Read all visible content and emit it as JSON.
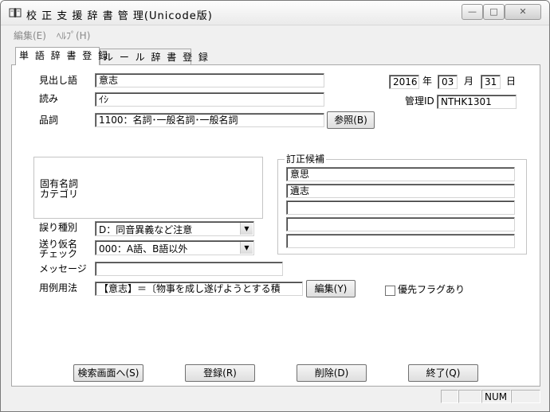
{
  "window": {
    "title": "校 正 支 援 辞 書 管 理(Unicode版)",
    "minimize_glyph": "—",
    "maximize_glyph": "□",
    "close_glyph": "✕"
  },
  "menu": {
    "items": [
      "編集(E)",
      "ﾍﾙﾌﾟ(H)"
    ]
  },
  "tabs": [
    "単 語 辞 書 登 録",
    "ル ー ル 辞 書 登 録"
  ],
  "form": {
    "midashi": {
      "label": "見出し語",
      "value": "意志"
    },
    "yomi": {
      "label": "読み",
      "value": "ｲｼ"
    },
    "hinshi": {
      "label": "品詞",
      "value": "1100：名詞･一般名詞･一般名詞",
      "browse_button": "参照(B)"
    },
    "date": {
      "year": "2016",
      "year_unit": "年",
      "month": "03",
      "month_unit": "月",
      "day": "31",
      "day_unit": "日"
    },
    "kanri": {
      "label": "管理ID",
      "value": "NTHK1301"
    },
    "koyu": {
      "label_line1": "固有名詞",
      "label_line2": "カテゴリ"
    },
    "teisei": {
      "legend": "訂正候補",
      "candidates": [
        "意思",
        "遺志",
        "",
        "",
        ""
      ]
    },
    "ayamari": {
      "label": "誤り種別",
      "value": "D：同音異義など注意"
    },
    "okurigana": {
      "label_line1": "送り仮名",
      "label_line2": "チェック",
      "value": "000：A語、B語以外"
    },
    "message": {
      "label": "メッセージ",
      "value": ""
    },
    "yorei": {
      "label": "用例用法",
      "value": "【意志】＝〔物事を成し遂げようとする積",
      "edit_button": "編集(Y)"
    },
    "priority": {
      "label": "優先フラグあり",
      "checked": false
    }
  },
  "buttons": {
    "search": "検索画面へ(S)",
    "register": "登録(R)",
    "delete": "削除(D)",
    "exit": "終了(Q)"
  },
  "status": {
    "num": "NUM"
  }
}
